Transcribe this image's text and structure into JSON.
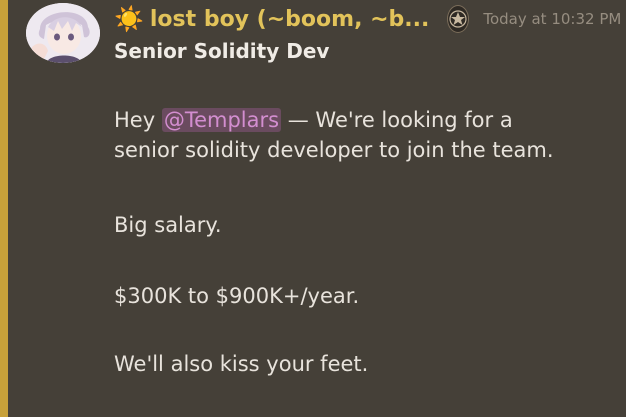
{
  "message": {
    "sun_icon": "☀️",
    "username": "lost boy (~boom, ~b...",
    "timestamp": "Today at 10:32 PM",
    "title": "Senior Solidity Dev",
    "lines": {
      "l1_prefix": "Hey ",
      "mention": "@Templars",
      "l1_suffix": " — We're looking for a",
      "l2": "senior solidity developer to join the team.",
      "p2": "Big salary.",
      "p3": "$300K to $900K+/year.",
      "p4": "We'll also kiss your feet."
    }
  },
  "colors": {
    "background": "#454038",
    "accent_bar": "#c7a13a",
    "username": "#e2c35a",
    "mention_bg": "#6a4b5f",
    "mention_text": "#d38ed0"
  }
}
